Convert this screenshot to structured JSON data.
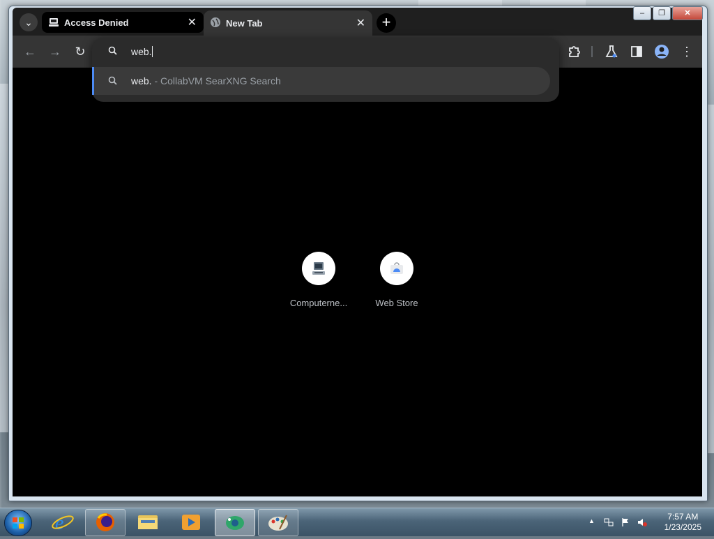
{
  "browser": {
    "tabs": [
      {
        "title": "Access Denied",
        "favicon": "computer-favicon",
        "active": false
      },
      {
        "title": "New Tab",
        "favicon": "globe-icon",
        "active": true
      }
    ],
    "window_controls": {
      "minimize": "‒",
      "maximize": "❐",
      "close": "✕"
    },
    "nav": {
      "back": "←",
      "forward": "→",
      "reload": "↻"
    },
    "toolbar_icons": [
      "puzzle-extensions-icon",
      "flask-labs-icon",
      "side-panel-icon",
      "profile-icon",
      "more-menu-icon"
    ]
  },
  "omnibox": {
    "value": "web.",
    "suggestions": [
      {
        "query": "web.",
        "description": " - CollabVM SearXNG Search"
      }
    ]
  },
  "new_tab": {
    "shortcuts": [
      {
        "label": "Computerne...",
        "icon": "computer-icon"
      },
      {
        "label": "Web Store",
        "icon": "web-store-icon"
      }
    ]
  },
  "taskbar": {
    "pinned": [
      "internet-explorer-icon",
      "firefox-icon",
      "file-explorer-icon",
      "media-player-icon",
      "chrome-app-icon",
      "paint-icon"
    ],
    "clock": {
      "time": "7:57 AM",
      "date": "1/23/2025"
    }
  },
  "colors": {
    "accent": "#4c8bf5",
    "toolbar": "#353535",
    "page_bg": "#000000"
  }
}
